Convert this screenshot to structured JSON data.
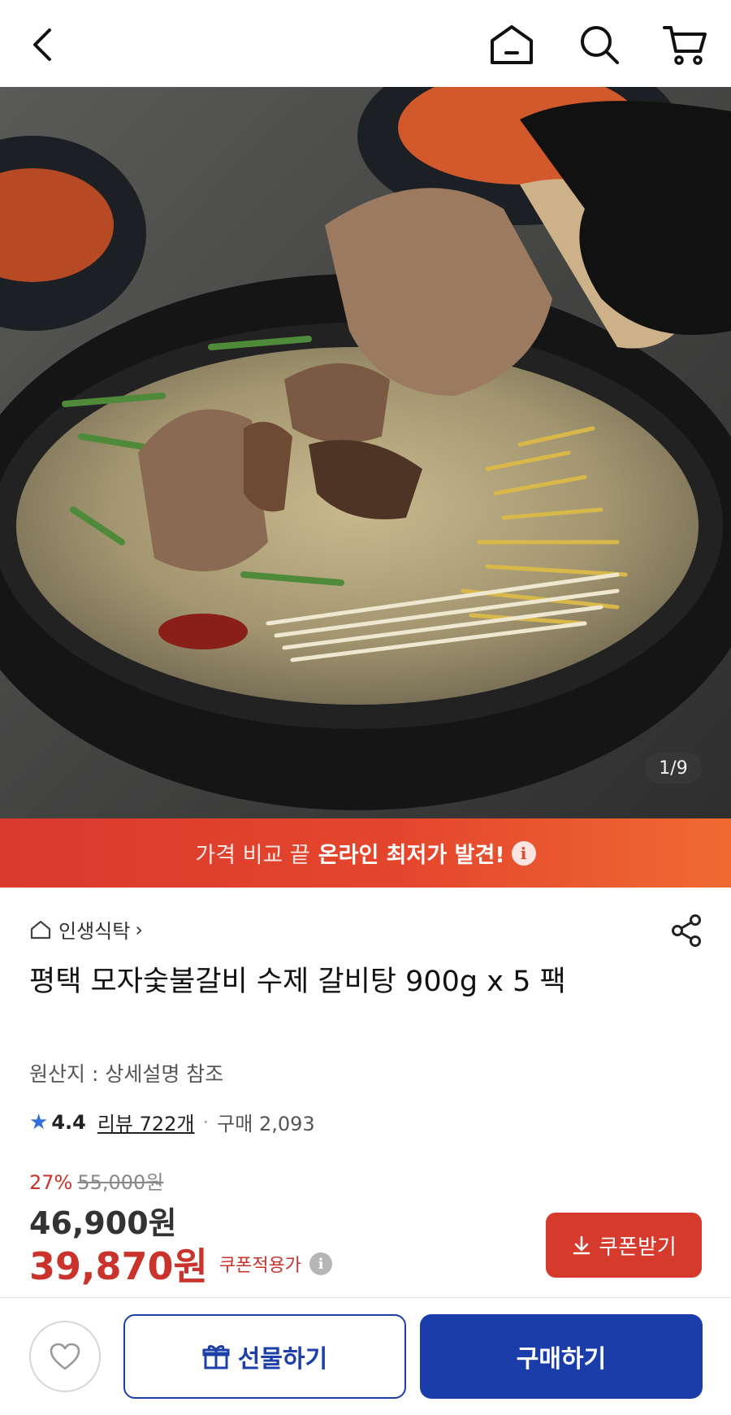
{
  "header": {
    "back_icon": "chevron-left-icon",
    "home_icon": "home-icon",
    "search_icon": "search-icon",
    "cart_icon": "cart-icon"
  },
  "gallery": {
    "counter": "1/9",
    "image_icon": "galbitang-soup-photo"
  },
  "banner": {
    "light_text": "가격 비교 끝",
    "bold_text": "온라인 최저가 발견!",
    "info_glyph": "i",
    "colors": {
      "start": "#d93a2e",
      "end": "#ef6a32"
    }
  },
  "product": {
    "store_name": "인생식탁",
    "store_chevron": "›",
    "title": "평택 모자숯불갈비 수제 갈비탕 900g x 5 팩",
    "origin": "원산지 : 상세설명 참조",
    "rating": "4.4",
    "reviews": "리뷰 722개",
    "separator": "·",
    "purchases": "구매 2,093",
    "discount_rate": "27%",
    "original_price": "55,000원",
    "price": "46,900원",
    "coupon_price": "39,870원",
    "coupon_label": "쿠폰적용가",
    "coupon_info_glyph": "i"
  },
  "actions": {
    "coupon_button": "쿠폰받기",
    "gift_button": "선물하기",
    "buy_button": "구매하기",
    "wishlist_icon": "heart-icon",
    "share_icon": "share-icon"
  },
  "colors": {
    "accent_red": "#c9332b",
    "primary_blue": "#1a3daa",
    "rating_star": "#2f6fe0"
  }
}
